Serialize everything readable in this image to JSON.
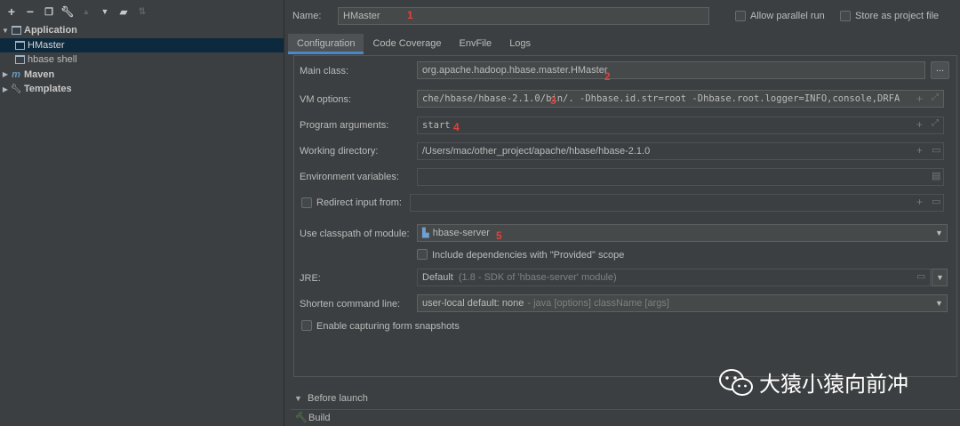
{
  "toolbar": {
    "icons": [
      "plus-icon",
      "minus-icon",
      "copy-icon",
      "wrench-icon",
      "arrow-up-icon",
      "arrow-down-icon",
      "folder-add-icon",
      "sort-icon"
    ]
  },
  "tree": {
    "application": "Application",
    "hmaster": "HMaster",
    "hbase_shell": "hbase shell",
    "maven": "Maven",
    "templates": "Templates"
  },
  "header": {
    "name_label": "Name:",
    "name_value": "HMaster",
    "allow_parallel": "Allow parallel run",
    "store_as_project": "Store as project file"
  },
  "tabs": [
    "Configuration",
    "Code Coverage",
    "EnvFile",
    "Logs"
  ],
  "form": {
    "main_class_label": "Main class:",
    "main_class_value": "org.apache.hadoop.hbase.master.HMaster",
    "browse_label": "...",
    "vm_options_label": "VM options:",
    "vm_options_value": "che/hbase/hbase-2.1.0/bin/. -Dhbase.id.str=root -Dhbase.root.logger=INFO,console,DRFA",
    "program_args_label": "Program arguments:",
    "program_args_value": "start",
    "working_dir_label": "Working directory:",
    "working_dir_value": "/Users/mac/other_project/apache/hbase/hbase-2.1.0",
    "env_vars_label": "Environment variables:",
    "env_vars_value": "",
    "redirect_label": "Redirect input from:",
    "classpath_label": "Use classpath of module:",
    "classpath_value": "hbase-server",
    "include_provided": "Include dependencies with \"Provided\" scope",
    "jre_label": "JRE:",
    "jre_value": "Default",
    "jre_hint": "(1.8 - SDK of 'hbase-server' module)",
    "shorten_label": "Shorten command line:",
    "shorten_value": "user-local default: none",
    "shorten_hint": "- java [options] className [args]",
    "snapshots_label": "Enable capturing form snapshots"
  },
  "before_launch": {
    "title": "Before launch",
    "build": "Build"
  },
  "annotations": [
    "1",
    "2",
    "3",
    "4",
    "5"
  ],
  "watermark": "大猿小猿向前冲",
  "colors": {
    "background": "#3c3f41",
    "selection": "#0d293e",
    "accent": "#4a88c7",
    "annotation": "#e5403a"
  }
}
